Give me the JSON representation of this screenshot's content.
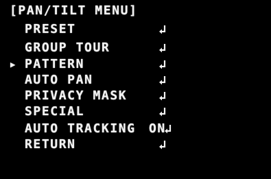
{
  "menu": {
    "title": "[PAN/TILT MENU]",
    "cursor_glyph": "▶",
    "selected_index": 2,
    "items": [
      {
        "label": "PRESET",
        "value": "",
        "enter_icon": "enter-return-icon"
      },
      {
        "label": "GROUP TOUR",
        "value": "",
        "enter_icon": "enter-return-icon"
      },
      {
        "label": "PATTERN",
        "value": "",
        "enter_icon": "enter-return-icon"
      },
      {
        "label": "AUTO PAN",
        "value": "",
        "enter_icon": "enter-return-icon"
      },
      {
        "label": "PRIVACY MASK",
        "value": "",
        "enter_icon": "enter-return-icon"
      },
      {
        "label": "SPECIAL",
        "value": "",
        "enter_icon": "enter-return-icon"
      },
      {
        "label": "AUTO TRACKING",
        "value": "ON",
        "enter_icon": "enter-return-icon"
      },
      {
        "label": "RETURN",
        "value": "",
        "enter_icon": "enter-return-icon"
      }
    ]
  },
  "colors": {
    "background": "#000000",
    "text": "#f2f2f2"
  }
}
